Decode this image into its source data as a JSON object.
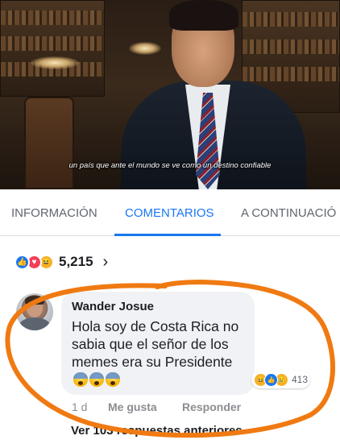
{
  "video": {
    "subtitle": "un país que ante el mundo se ve como un destino confiable"
  },
  "tabs": [
    {
      "label": "INFORMACIÓN",
      "active": false
    },
    {
      "label": "COMENTARIOS",
      "active": true
    },
    {
      "label": "A CONTINUACIÓ",
      "active": false
    }
  ],
  "accent_color": "#1877f2",
  "reactions": {
    "icons": [
      "like-icon",
      "love-icon",
      "haha-icon"
    ],
    "count": "5,215",
    "chevron": "›"
  },
  "comment": {
    "author": "Wander Josue",
    "text": "Hola soy de Costa Rica no sabia que el señor de los memes era su Presidente",
    "emoji": [
      "fearful-face-icon",
      "fearful-face-icon",
      "fearful-face-icon"
    ],
    "reaction_icons": [
      "haha-icon",
      "like-icon",
      "sad-icon"
    ],
    "reaction_count": "413",
    "time": "1 d",
    "like_label": "Me gusta",
    "reply_label": "Responder"
  },
  "view_replies": "Ver 103 respuestas anteriores",
  "annotation_color": "#f07a12"
}
